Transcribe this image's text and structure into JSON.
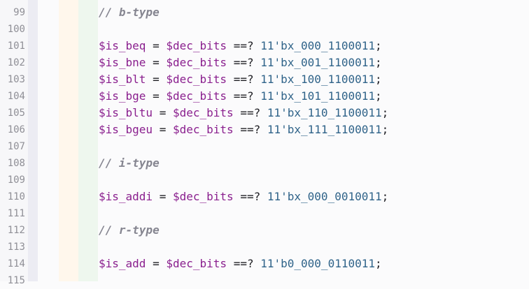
{
  "lines": [
    {
      "num": "99",
      "type": "comment",
      "text": "// b-type"
    },
    {
      "num": "100",
      "type": "blank"
    },
    {
      "num": "101",
      "type": "assign",
      "var": "$is_beq",
      "rhs": "$dec_bits",
      "op": "==?",
      "val": "11'bx_000_1100011"
    },
    {
      "num": "102",
      "type": "assign",
      "var": "$is_bne",
      "rhs": "$dec_bits",
      "op": "==?",
      "val": "11'bx_001_1100011"
    },
    {
      "num": "103",
      "type": "assign",
      "var": "$is_blt",
      "rhs": "$dec_bits",
      "op": "==?",
      "val": "11'bx_100_1100011"
    },
    {
      "num": "104",
      "type": "assign",
      "var": "$is_bge",
      "rhs": "$dec_bits",
      "op": "==?",
      "val": "11'bx_101_1100011"
    },
    {
      "num": "105",
      "type": "assign",
      "var": "$is_bltu",
      "rhs": "$dec_bits",
      "op": "==?",
      "val": "11'bx_110_1100011"
    },
    {
      "num": "106",
      "type": "assign",
      "var": "$is_bgeu",
      "rhs": "$dec_bits",
      "op": "==?",
      "val": "11'bx_111_1100011"
    },
    {
      "num": "107",
      "type": "blank"
    },
    {
      "num": "108",
      "type": "comment",
      "text": "// i-type"
    },
    {
      "num": "109",
      "type": "blank"
    },
    {
      "num": "110",
      "type": "assign",
      "var": "$is_addi",
      "rhs": "$dec_bits",
      "op": "==?",
      "val": "11'bx_000_0010011"
    },
    {
      "num": "111",
      "type": "blank"
    },
    {
      "num": "112",
      "type": "comment",
      "text": "// r-type"
    },
    {
      "num": "113",
      "type": "blank"
    },
    {
      "num": "114",
      "type": "assign",
      "var": "$is_add",
      "rhs": "$dec_bits",
      "op": "==?",
      "val": "11'b0_000_0110011"
    },
    {
      "num": "115",
      "type": "blank"
    }
  ]
}
